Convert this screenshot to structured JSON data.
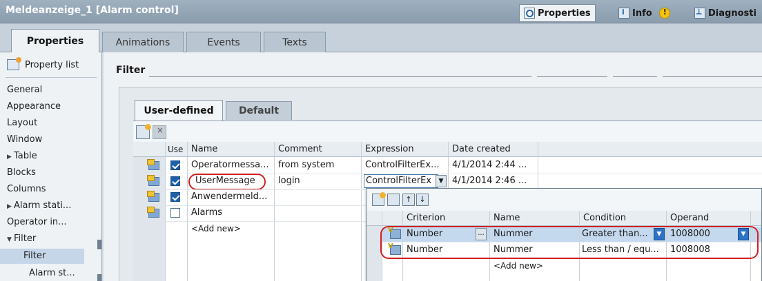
{
  "title_bar": {
    "title": "Meldeanzeige_1 [Alarm control]",
    "properties": "Properties",
    "info": "Info",
    "diagnostics": "Diagnosti"
  },
  "main_tabs": [
    "Properties",
    "Animations",
    "Events",
    "Texts"
  ],
  "sidebar": {
    "property_list": "Property list",
    "items": [
      "General",
      "Appearance",
      "Layout",
      "Window",
      "Table",
      "Blocks",
      "Columns",
      "Alarm stati...",
      "Operator in...",
      "Filter",
      "Filter",
      "Alarm st..."
    ]
  },
  "filter": {
    "label": "Filter"
  },
  "sub_tabs": [
    "User-defined",
    "Default"
  ],
  "filters_table": {
    "headers": [
      "Use",
      "Name",
      "Comment",
      "Expression",
      "Date created"
    ],
    "rows": [
      {
        "name": "Operatormessa...",
        "comment": "from system",
        "expression": "ControlFilterEx...",
        "date": "4/1/2014 2:44 ...",
        "checked": true
      },
      {
        "name": "UserMessage",
        "comment": "login",
        "expression": "ControlFilterEx",
        "date": "4/1/2014 2:46 ...",
        "checked": true
      },
      {
        "name": "Anwendermeld...",
        "comment": "",
        "expression": "",
        "date": "",
        "checked": true
      },
      {
        "name": "Alarms",
        "comment": "",
        "expression": "",
        "date": "",
        "checked": false
      }
    ],
    "add_new": "<Add new>"
  },
  "criteria_table": {
    "headers": [
      "Criterion",
      "Name",
      "Condition",
      "Operand"
    ],
    "rows": [
      {
        "criterion": "Number",
        "name": "Nummer",
        "condition": "Greater than...",
        "operand": "1008000"
      },
      {
        "criterion": "Number",
        "name": "Nummer",
        "condition": "Less than / equ...",
        "operand": "1008008"
      }
    ],
    "add_new": "<Add new>",
    "ellipsis": "..."
  },
  "colors": {
    "title_bar": "#8a9cad",
    "highlight": "#d32020",
    "checkbox": "#1f5fa8",
    "selection": "#c5d9ee"
  }
}
